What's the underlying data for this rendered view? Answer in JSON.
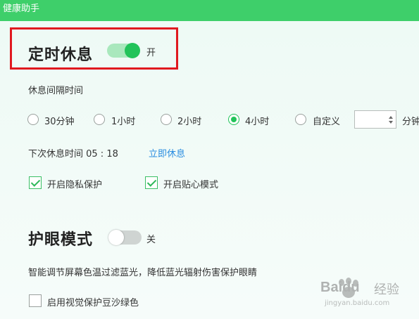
{
  "window": {
    "title": "健康助手"
  },
  "rest": {
    "title": "定时休息",
    "toggle_state": "开",
    "interval_label": "休息间隔时间",
    "options": [
      "30分钟",
      "1小时",
      "2小时",
      "4小时",
      "自定义"
    ],
    "selected_option": "4小时",
    "custom_value": "",
    "custom_unit": "分钟",
    "next_rest_label": "下次休息时间 05 : 18",
    "rest_now_link": "立即休息",
    "checkboxes": [
      {
        "label": "开启隐私保护",
        "checked": true
      },
      {
        "label": "开启贴心模式",
        "checked": true
      }
    ]
  },
  "eye_care": {
    "title": "护眼模式",
    "toggle_state": "关",
    "description": "智能调节屏幕色温过滤蓝光，降低蓝光辐射伤害保护眼睛",
    "checkbox_label": "启用视觉保护豆沙绿色",
    "checkbox_checked": false
  },
  "watermark": {
    "brand": "Baidu",
    "sub": "经验",
    "url": "jingyan.baidu.com"
  },
  "colors": {
    "accent": "#3ecf6a",
    "toggle_on": "#22c35a",
    "link": "#2a8de0",
    "highlight": "#e0191f"
  }
}
